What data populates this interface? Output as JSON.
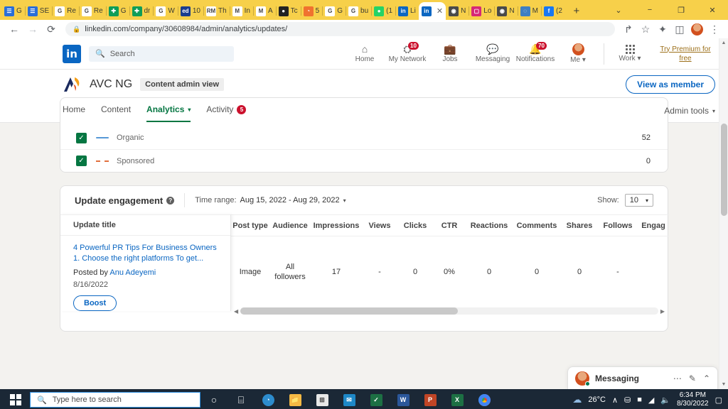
{
  "browser": {
    "tabs": [
      {
        "label": "G",
        "icon": "doc-icon",
        "color": "#2a6ed8",
        "glyph": "☰",
        "active": false
      },
      {
        "label": "SE",
        "icon": "doc-icon",
        "color": "#2a6ed8",
        "glyph": "☰",
        "active": false
      },
      {
        "label": "Re",
        "icon": "google-icon",
        "color": "#ffffff",
        "glyph": "G",
        "active": false
      },
      {
        "label": "Re",
        "icon": "google-icon",
        "color": "#ffffff",
        "glyph": "G",
        "active": false
      },
      {
        "label": "G",
        "icon": "sheets-icon",
        "color": "#0f9d58",
        "glyph": "✚",
        "active": false
      },
      {
        "label": "dr",
        "icon": "sheets-icon",
        "color": "#0f9d58",
        "glyph": "✚",
        "active": false
      },
      {
        "label": "W",
        "icon": "google-icon",
        "color": "#ffffff",
        "glyph": "G",
        "active": false
      },
      {
        "label": "10",
        "icon": "ed-icon",
        "color": "#1a3d8f",
        "glyph": "ed",
        "active": false
      },
      {
        "label": "Th",
        "icon": "rm-icon",
        "color": "#ffffff",
        "glyph": "RM",
        "active": false
      },
      {
        "label": "In",
        "icon": "gmail-icon",
        "color": "#ffffff",
        "glyph": "M",
        "active": false
      },
      {
        "label": "A",
        "icon": "gmail-icon",
        "color": "#ffffff",
        "glyph": "M",
        "active": false
      },
      {
        "label": "Tc",
        "icon": "record-icon",
        "color": "#222222",
        "glyph": "●",
        "active": false
      },
      {
        "label": "5",
        "icon": "clock-icon",
        "color": "#f0722f",
        "glyph": "◔",
        "active": false
      },
      {
        "label": "G",
        "icon": "google-icon",
        "color": "#ffffff",
        "glyph": "G",
        "active": false
      },
      {
        "label": "bu",
        "icon": "google-icon",
        "color": "#ffffff",
        "glyph": "G",
        "active": false
      },
      {
        "label": "(1",
        "icon": "whatsapp-icon",
        "color": "#25d366",
        "glyph": "●",
        "active": false
      },
      {
        "label": "Li",
        "icon": "linkedin-icon",
        "color": "#0a66c2",
        "glyph": "in",
        "active": false
      },
      {
        "label": "",
        "icon": "linkedin-icon",
        "color": "#0a66c2",
        "glyph": "in",
        "active": true
      },
      {
        "label": "N",
        "icon": "chrome-icon",
        "color": "#4a4a4a",
        "glyph": "◉",
        "active": false
      },
      {
        "label": "Lo",
        "icon": "instagram-icon",
        "color": "#d62976",
        "glyph": "▢",
        "active": false
      },
      {
        "label": "N",
        "icon": "chrome-icon",
        "color": "#4a4a4a",
        "glyph": "◉",
        "active": false
      },
      {
        "label": "M",
        "icon": "globe-icon",
        "color": "#3f7fc1",
        "glyph": "◌",
        "active": false
      },
      {
        "label": "(2",
        "icon": "facebook-icon",
        "color": "#1877f2",
        "glyph": "f",
        "active": false
      }
    ],
    "tab_close_glyph": "✕",
    "new_tab_glyph": "+",
    "window_controls": {
      "minimize": "−",
      "maximize": "❐",
      "close": "✕",
      "tablist": "⌄"
    },
    "nav": {
      "back": "←",
      "forward": "→",
      "reload": "⟳"
    },
    "address": {
      "lock": "🔒",
      "url": "linkedin.com/company/30608984/admin/analytics/updates/"
    },
    "toolbar_icons": {
      "share": "↱",
      "bookmark": "☆",
      "extensions": "✦",
      "sidepanel": "◫",
      "menu": "⋮"
    }
  },
  "linkedin": {
    "logo_text": "in",
    "search": {
      "placeholder": "Search",
      "icon": "search-icon"
    },
    "nav_items": [
      {
        "label": "Home",
        "icon": "home-icon",
        "glyph": "⌂",
        "badge": ""
      },
      {
        "label": "My Network",
        "icon": "network-icon",
        "glyph": "⛭",
        "badge": "10"
      },
      {
        "label": "Jobs",
        "icon": "jobs-icon",
        "glyph": "💼",
        "badge": ""
      },
      {
        "label": "Messaging",
        "icon": "messaging-icon",
        "glyph": "💬",
        "badge": ""
      },
      {
        "label": "Notifications",
        "icon": "bell-icon",
        "glyph": "🔔",
        "badge": "70"
      }
    ],
    "me": {
      "label": "Me",
      "caret": "▾"
    },
    "work": {
      "label": "Work",
      "caret": "▾",
      "icon": "grid-icon"
    },
    "premium_link": "Try Premium for free"
  },
  "company": {
    "name": "AVC NG",
    "admin_badge": "Content admin view",
    "view_as_member": "View as member",
    "tabs": [
      {
        "label": "Home",
        "badge": "",
        "active": false
      },
      {
        "label": "Content",
        "badge": "",
        "active": false
      },
      {
        "label": "Analytics",
        "badge": "",
        "active": true,
        "caret": "▾"
      },
      {
        "label": "Activity",
        "badge": "5",
        "active": false
      }
    ],
    "admin_tools": {
      "label": "Admin tools",
      "caret": "▾"
    }
  },
  "chart_card": {
    "x_ticks": [
      "",
      "",
      "",
      "",
      "",
      "",
      "",
      ""
    ],
    "legend": [
      {
        "label": "Organic",
        "style": "solid",
        "color": "#5698d6",
        "value": "52",
        "checked": true
      },
      {
        "label": "Sponsored",
        "style": "dashed",
        "color": "#e16f3d",
        "value": "0",
        "checked": true
      }
    ],
    "check_glyph": "✓"
  },
  "update_engagement": {
    "title": "Update engagement",
    "help_glyph": "?",
    "time_range_label": "Time range:",
    "time_range_value": "Aug 15, 2022 - Aug 29, 2022",
    "time_range_caret": "▾",
    "show_label": "Show:",
    "show_value": "10",
    "show_caret": "▾",
    "frozen_column": "Update title",
    "columns": [
      "Post type",
      "Audience",
      "Impressions",
      "Views",
      "Clicks",
      "CTR",
      "Reactions",
      "Comments",
      "Shares",
      "Follows",
      "Engag"
    ],
    "rows": [
      {
        "title": "4 Powerful PR Tips For Business Owners 1. Choose the right platforms To get...",
        "posted_by_prefix": "Posted by",
        "author": "Anu Adeyemi",
        "date": "8/16/2022",
        "boost_label": "Boost",
        "values": [
          "Image",
          "All followers",
          "17",
          "-",
          "0",
          "0%",
          "0",
          "0",
          "0",
          "-",
          ""
        ]
      }
    ],
    "scroll_left_glyph": "◀",
    "scroll_right_glyph": "▶"
  },
  "messaging_widget": {
    "title": "Messaging",
    "more_glyph": "⋯",
    "compose_glyph": "✎",
    "chevron_glyph": "⌃"
  },
  "scrollbar": {
    "up": "▲",
    "down": "▼"
  },
  "taskbar": {
    "search_placeholder": "Type here to search",
    "search_icon": "search-icon",
    "cortana_glyph": "○",
    "taskview_glyph": "⌸",
    "apps": [
      {
        "name": "edge-icon",
        "glyph": "◔",
        "color": "#2d8ccd"
      },
      {
        "name": "file-explorer-icon",
        "glyph": "📁",
        "color": "#f5b944"
      },
      {
        "name": "store-icon",
        "glyph": "⊞",
        "color": "#e8e8e8"
      },
      {
        "name": "mail-icon",
        "glyph": "✉",
        "color": "#1e88c7"
      },
      {
        "name": "excel-green-icon",
        "glyph": "✓",
        "color": "#1d7044"
      },
      {
        "name": "word-icon",
        "glyph": "W",
        "color": "#2b579a"
      },
      {
        "name": "powerpoint-icon",
        "glyph": "P",
        "color": "#c04526"
      },
      {
        "name": "excel-icon",
        "glyph": "X",
        "color": "#1d7044"
      },
      {
        "name": "chrome-icon",
        "glyph": "◉",
        "color": "#f2f2f2"
      }
    ],
    "tray": {
      "weather_temp": "26°C",
      "weather_icon": "cloud-icon",
      "chevron": "∧",
      "onedrive": "☁",
      "battery": "🔋",
      "wifi": "◠",
      "volume": "🔊",
      "time": "6:34 PM",
      "date": "8/30/2022",
      "action_center": "▢"
    }
  }
}
